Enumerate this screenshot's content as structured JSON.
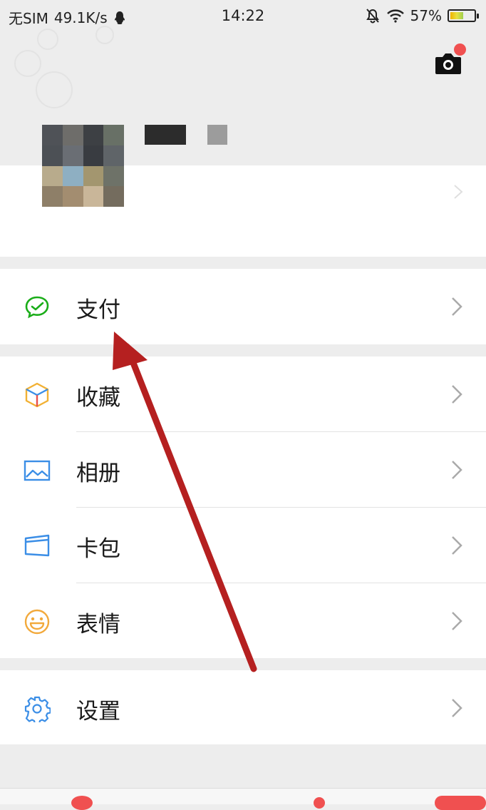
{
  "status_bar": {
    "carrier": "无SIM",
    "speed": "49.1K/s",
    "time": "14:22",
    "battery": "57%",
    "battery_level": 0.57
  },
  "menu": {
    "pay": {
      "label": "支付",
      "icon": "wechat-pay-icon"
    },
    "favorites": {
      "label": "收藏",
      "icon": "cube-icon"
    },
    "album": {
      "label": "相册",
      "icon": "image-icon"
    },
    "cards": {
      "label": "卡包",
      "icon": "card-icon"
    },
    "stickers": {
      "label": "表情",
      "icon": "smiley-icon"
    },
    "settings": {
      "label": "设置",
      "icon": "gear-icon"
    }
  },
  "colors": {
    "accent_green": "#1aad19",
    "annotation_arrow": "#b52020",
    "badge_red": "#f05050"
  }
}
